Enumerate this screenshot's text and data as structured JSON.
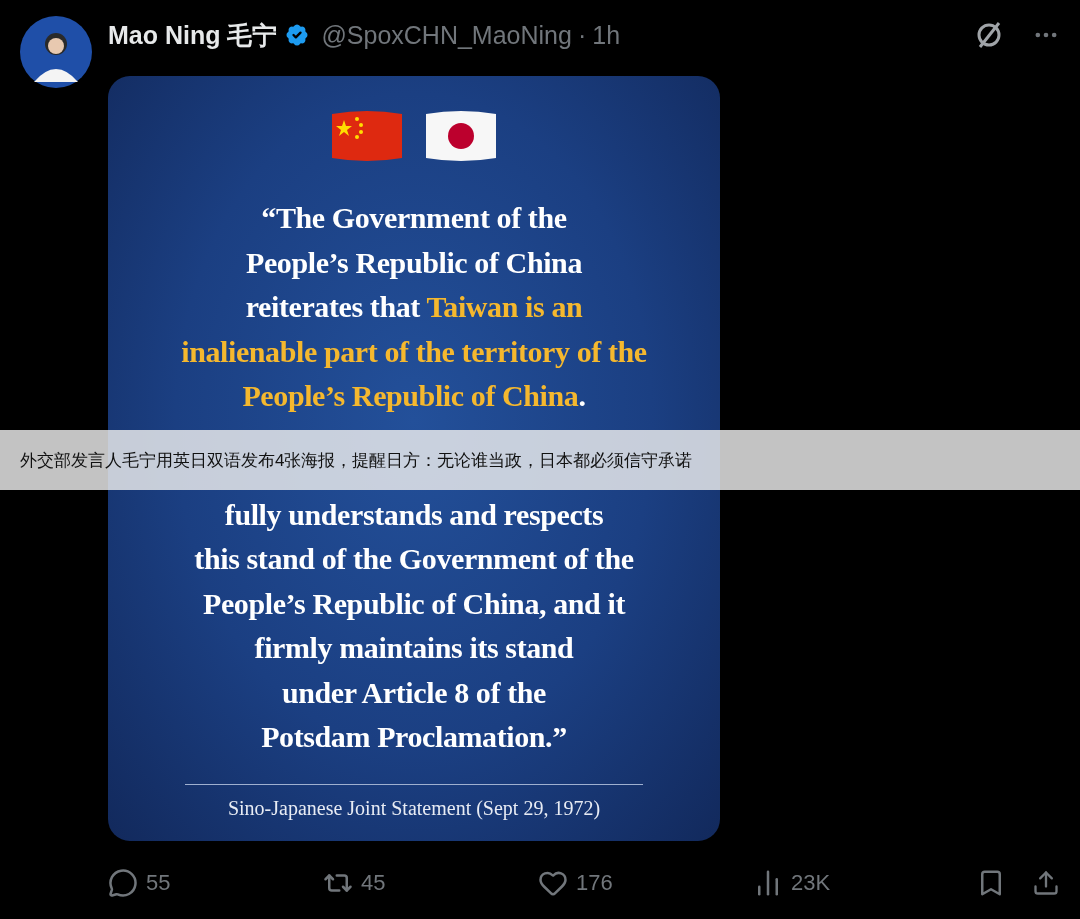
{
  "tweet": {
    "author": {
      "name": "Mao Ning 毛宁",
      "verified": true,
      "handle": "@SpoxCHN_MaoNing",
      "separator": "·",
      "time": "1h"
    },
    "poster": {
      "quote_lines_above_banner": [
        [
          {
            "text": "“The Government of the",
            "highlight": false
          }
        ],
        [
          {
            "text": "People’s Republic of China",
            "highlight": false
          }
        ],
        [
          {
            "text": "reiterates that ",
            "highlight": false
          },
          {
            "text": "Taiwan is an",
            "highlight": true
          }
        ],
        [
          {
            "text": "inalienable part of the territory of the",
            "highlight": true
          }
        ],
        [
          {
            "text": "People’s Republic of China",
            "highlight": true
          },
          {
            "text": ".",
            "highlight": false
          }
        ]
      ],
      "quote_lines_below_banner": [
        [
          {
            "text": "fully understands and respects",
            "highlight": false
          }
        ],
        [
          {
            "text": "this stand of the Government of the",
            "highlight": false
          }
        ],
        [
          {
            "text": "People’s Republic of China, and it",
            "highlight": false
          }
        ],
        [
          {
            "text": "firmly maintains its stand",
            "highlight": false
          }
        ],
        [
          {
            "text": "under Article 8 of the",
            "highlight": false
          }
        ],
        [
          {
            "text": "Potsdam Proclamation.”",
            "highlight": false
          }
        ]
      ],
      "source": "Sino-Japanese Joint Statement (Sept 29, 1972)"
    },
    "actions": [
      {
        "kind": "reply",
        "count": "55"
      },
      {
        "kind": "repost",
        "count": "45"
      },
      {
        "kind": "like",
        "count": "176"
      },
      {
        "kind": "views",
        "count": "23K"
      }
    ]
  },
  "caption_banner": "外交部发言人毛宁用英日双语发布4张海报，提醒日方：无论谁当政，日本都必须信守承诺"
}
